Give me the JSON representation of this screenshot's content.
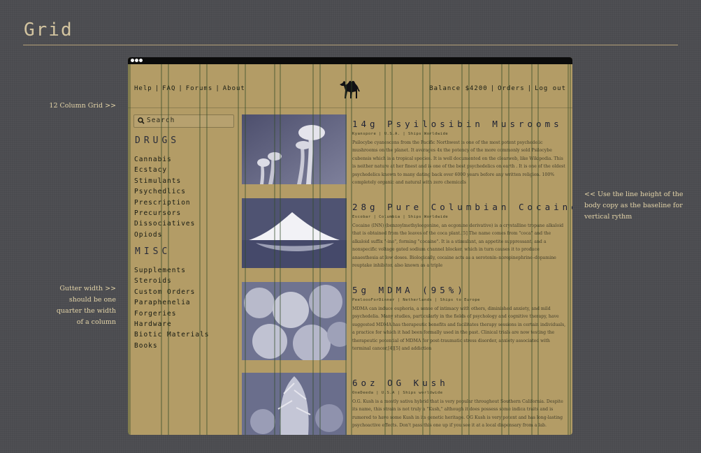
{
  "page": {
    "title": "Grid",
    "notes": {
      "column_grid": "12 Column Grid >>",
      "gutter_lines": [
        "Gutter width >>",
        "should be one",
        "quarter the width",
        "of a column"
      ],
      "line_height_lines": [
        "<< Use the line height of the",
        "body copy as the baseline for",
        "vertical rythm"
      ]
    }
  },
  "site": {
    "nav_left": [
      "Help",
      "FAQ",
      "Forums",
      "About"
    ],
    "nav_right": [
      "Balance $4200",
      "Orders",
      "Log out"
    ],
    "logo_icon": "camel-icon",
    "search_placeholder": "Search",
    "drugs_heading": "DRUGS",
    "drugs": [
      "Cannabis",
      "Ecstacy",
      "Stimulants",
      "Psychedlics",
      "Prescription",
      "Precursors",
      "Dissociatives",
      "Opiods"
    ],
    "misc_heading": "MISC",
    "misc": [
      "Supplements",
      "Steroids",
      "Custom Orders",
      "Paraphenelia",
      "Forgeries",
      "Hardware",
      "Biotic Materials",
      "Books"
    ],
    "products": [
      {
        "title": "14g Psyilosibin Musrooms",
        "meta": "Kyanspore  |  U.S.A.  |  Ships Worldwide",
        "desc": "Psilocybe cyanescens from the Pacific Northwest is one of the most potent psychedelic mushrooms on the planet. It averages 4x the potency of the more commonly sold Psilocybe cubensis which is a tropical species. It is well documented on the clearweb, like Wikipedia. This is neither nature at her finest and is one of the best psychedelics on earth . It is one of the oldest psychedelics known to many dating back over 6000 years before any written religion. 100% completely organic and natural with zero chemicals"
      },
      {
        "title": "28g Pure Columbian Cocaine",
        "meta": "Escobar  |  Columbia  |  Ships Worldwide",
        "desc": "Cocaine (INN) (benzoylmethylecgonine, an ecgonine derivative) is a crystalline tropane alkaloid that is obtained from the leaves of the coca plant.[5] The name comes from \"coca\" and the alkaloid suffix \"-ine\", forming \"cocaine\". It is a stimulant, an appetite suppressant, and a nonspecific voltage gated sodium channel blocker, which in turn causes it to produce anaesthesia at low doses. Biologically, cocaine acts as a serotonin–norepinephrine–dopamine reuptake inhibitor, also known as a triple"
      },
      {
        "title": "5g MDMA (95%)",
        "meta": "PeeloooForDinner  |  Netherlands  |  Ships to Europe",
        "desc": "MDMA can induce euphoria, a sense of intimacy with others, diminished anxiety, and mild psychedelia. Many studies, particularly in the fields of psychology and cognitive therapy, have suggested MDMA has therapeutic benefits and facilitates therapy sessions in certain individuals, a practice for which it had been formally used in the past. Clinical trials are now testing the therapeutic potential of MDMA for post-traumatic stress disorder, anxiety associated with terminal cancer,[4][5] and addiction"
      },
      {
        "title": "6oz OG Kush",
        "meta": "OneDeeda  |  U.S.A  |  Ships worldwide",
        "desc": "O.G. Kush is a mostly sativa hybrid that is very popular throughout Southern California. Despite its name, this strain is not truly a \"Kush,\" although it does possess some indica traits and is rumored to have some Kush in its genetic heritage. OG Kush is very potent and has long-lasting psychoactive effects. Don't pass this one up if you see it at a local dispensary from a lab."
      }
    ]
  }
}
